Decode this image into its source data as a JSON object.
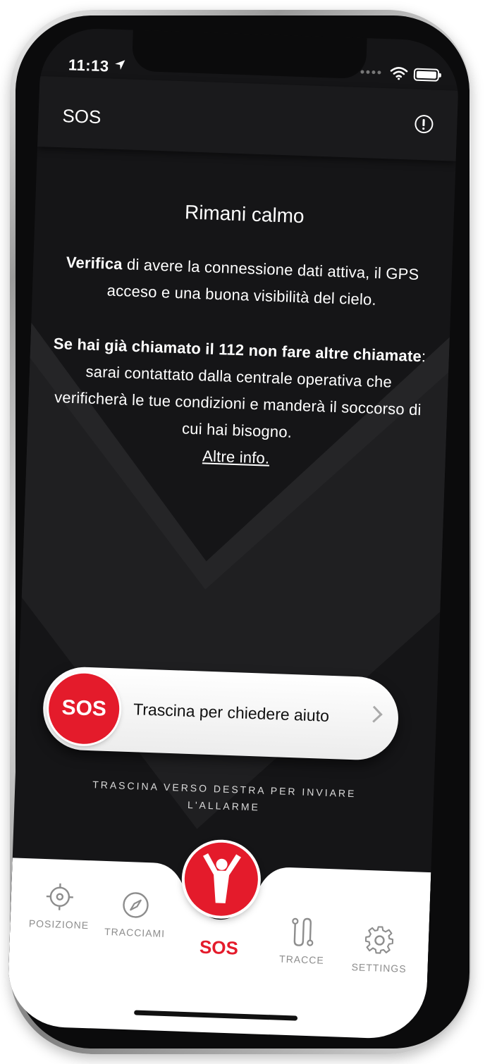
{
  "status_bar": {
    "time": "11:13"
  },
  "header": {
    "title": "SOS",
    "info_icon": "info-circle-icon"
  },
  "message": {
    "title": "Rimani calmo",
    "para1_bold": "Verifica",
    "para1_rest": " di avere la connessione dati attiva, il GPS acceso e una buona visibilità del cielo.",
    "para2_bold": "Se hai già chiamato il 112 non fare altre chiamate",
    "para2_rest": ": sarai contattato dalla centrale operativa che verificherà le tue condizioni e manderà il soccorso di cui hai bisogno.",
    "more_info_link": "Altre info."
  },
  "slider": {
    "knob_label": "SOS",
    "label": "Trascina per chiedere aiuto",
    "hint": "TRASCINA VERSO DESTRA PER INVIARE L'ALLARME"
  },
  "tabs": [
    {
      "label": "POSIZIONE",
      "icon": "crosshair-icon"
    },
    {
      "label": "TRACCIAMI",
      "icon": "compass-icon"
    },
    {
      "label": "SOS",
      "icon": "person-arms-up-icon",
      "active": true
    },
    {
      "label": "TRACCE",
      "icon": "route-icon"
    },
    {
      "label": "SETTINGS",
      "icon": "gear-icon"
    }
  ],
  "colors": {
    "accent": "#e41b2b",
    "background": "#151517",
    "tab_bar": "#ffffff"
  }
}
